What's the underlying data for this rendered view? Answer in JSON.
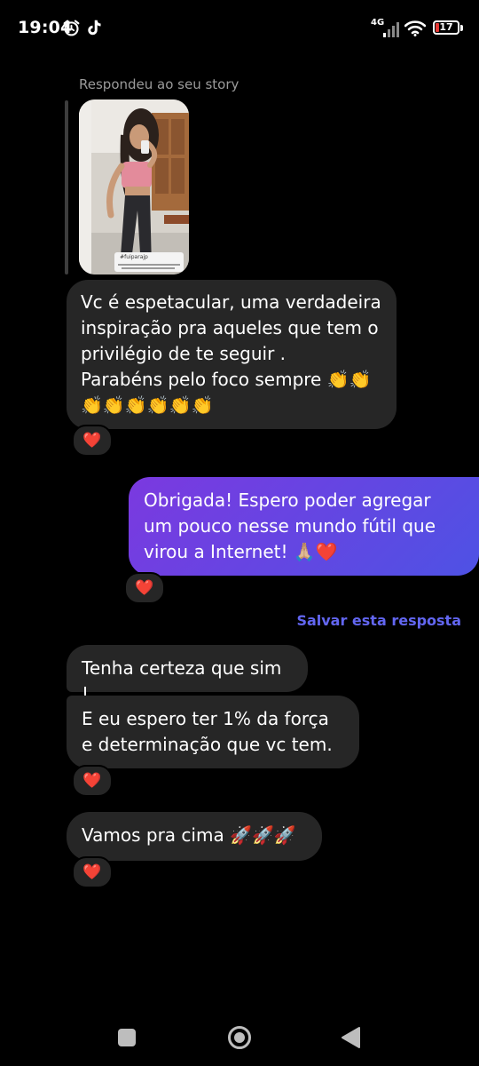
{
  "status": {
    "time": "19:04",
    "network": "4G",
    "battery": "17"
  },
  "chat": {
    "story_reply_label": "Respondeu ao seu story",
    "story_thumbnail_caption": "#fuiparajp",
    "messages": [
      {
        "from": "them",
        "text": "Vc é espetacular, uma verdadeira inspiração pra aqueles que tem o privilégio de te seguir .\nParabéns pelo foco sempre 👏👏\n👏👏👏👏👏👏",
        "reaction": "❤️"
      },
      {
        "from": "me",
        "text": "Obrigada! Espero poder agregar um pouco nesse mundo fútil que virou a Internet! 🙏🏼❤️",
        "reaction": "❤️"
      },
      {
        "from": "them",
        "text": "Tenha certeza que sim !"
      },
      {
        "from": "them",
        "text": "E eu espero ter 1% da força e determinação que vc tem.",
        "reaction": "❤️"
      },
      {
        "from": "them",
        "text": "Vamos pra cima 🚀🚀🚀",
        "reaction": "❤️"
      }
    ],
    "save_reply_label": "Salvar esta resposta"
  },
  "icons": {
    "alarm": "alarm-icon",
    "tiktok": "tiktok-icon",
    "signal": "signal-icon",
    "wifi": "wifi-icon",
    "battery": "battery-icon",
    "heart": "heart-icon",
    "recents": "recents-icon",
    "home": "home-icon",
    "back": "back-icon"
  },
  "colors": {
    "background": "#000000",
    "received_bubble": "#262626",
    "sent_bubble_start": "#7b39e0",
    "sent_bubble_end": "#4e52e4",
    "link": "#6266f1",
    "heart": "#e0243a"
  }
}
